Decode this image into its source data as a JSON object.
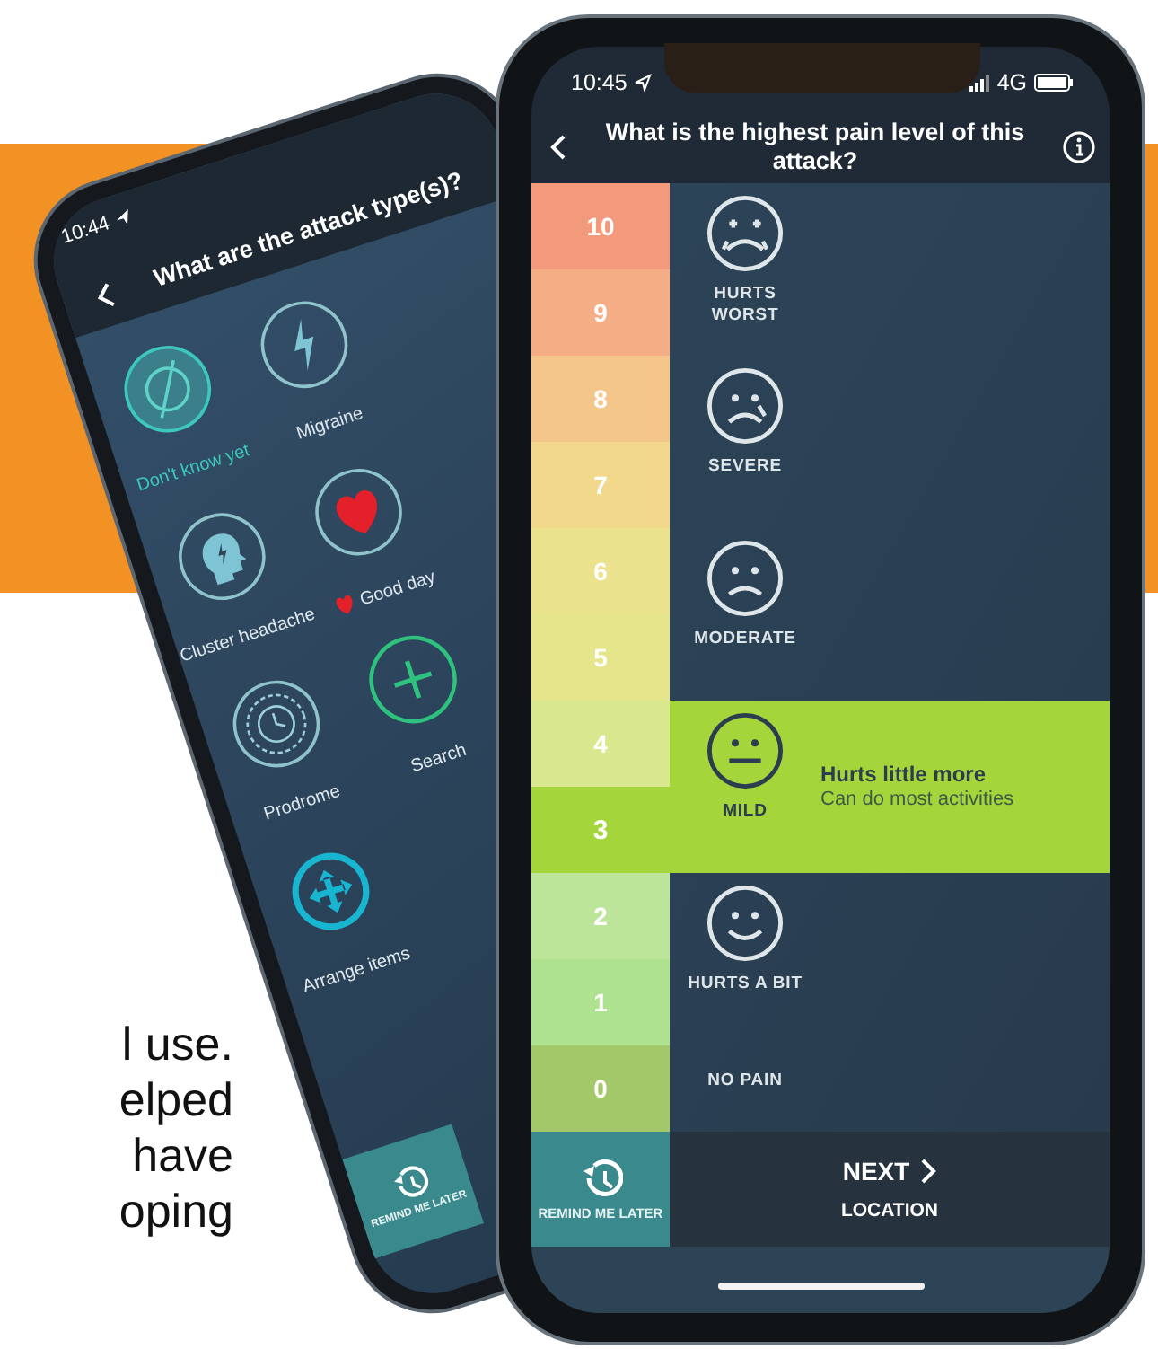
{
  "side_text": {
    "lines": [
      "l use.",
      "elped",
      "have",
      "oping"
    ]
  },
  "back_phone": {
    "status_time": "10:44",
    "title": "What are the attack type(s)?",
    "items": [
      {
        "kind": "unknown",
        "label": "Don't know yet",
        "selected": true
      },
      {
        "kind": "migraine",
        "label": "Migraine",
        "selected": false
      },
      {
        "kind": "cluster",
        "label": "Cluster headache",
        "selected": false
      },
      {
        "kind": "goodday",
        "label": "Good day",
        "selected": false
      },
      {
        "kind": "prodrome",
        "label": "Prodrome",
        "selected": false
      },
      {
        "kind": "search",
        "label": "Search",
        "selected": false
      },
      {
        "kind": "arrange",
        "label": "Arrange items",
        "selected": false
      }
    ],
    "remind_button": {
      "label": "REMIND ME LATER"
    }
  },
  "front_phone": {
    "status_time": "10:45",
    "network": "4G",
    "title": "What is the highest pain level of this attack?",
    "levels": [
      {
        "value": "10",
        "color": "#f39a7c",
        "selected": false
      },
      {
        "value": "9",
        "color": "#f5ad86",
        "selected": false
      },
      {
        "value": "8",
        "color": "#f5c68a",
        "selected": false
      },
      {
        "value": "7",
        "color": "#f2d88b",
        "selected": false
      },
      {
        "value": "6",
        "color": "#ebe28e",
        "selected": false
      },
      {
        "value": "5",
        "color": "#e5e68c",
        "selected": false
      },
      {
        "value": "4",
        "color": "#d9e78f",
        "selected": false
      },
      {
        "value": "3",
        "color": "#a4d53a",
        "selected": true
      },
      {
        "value": "2",
        "color": "#bce59a",
        "selected": false
      },
      {
        "value": "1",
        "color": "#aee28e",
        "selected": false
      },
      {
        "value": "0",
        "color": "#a3c86a",
        "selected": false
      }
    ],
    "faces": [
      {
        "kind": "worst",
        "label": "HURTS WORST",
        "selected": false
      },
      {
        "kind": "severe",
        "label": "SEVERE",
        "selected": false
      },
      {
        "kind": "moderate",
        "label": "MODERATE",
        "selected": false
      },
      {
        "kind": "mild",
        "label": "MILD",
        "selected": true,
        "detail": {
          "title": "Hurts little more",
          "subtitle": "Can do most activities"
        }
      },
      {
        "kind": "happy",
        "label": "HURTS A BIT",
        "selected": false
      },
      {
        "kind": "none",
        "label": "NO PAIN",
        "selected": false
      }
    ],
    "remind_button": {
      "label": "REMIND ME LATER"
    },
    "next_button": {
      "label": "NEXT",
      "sublabel": "LOCATION"
    }
  }
}
